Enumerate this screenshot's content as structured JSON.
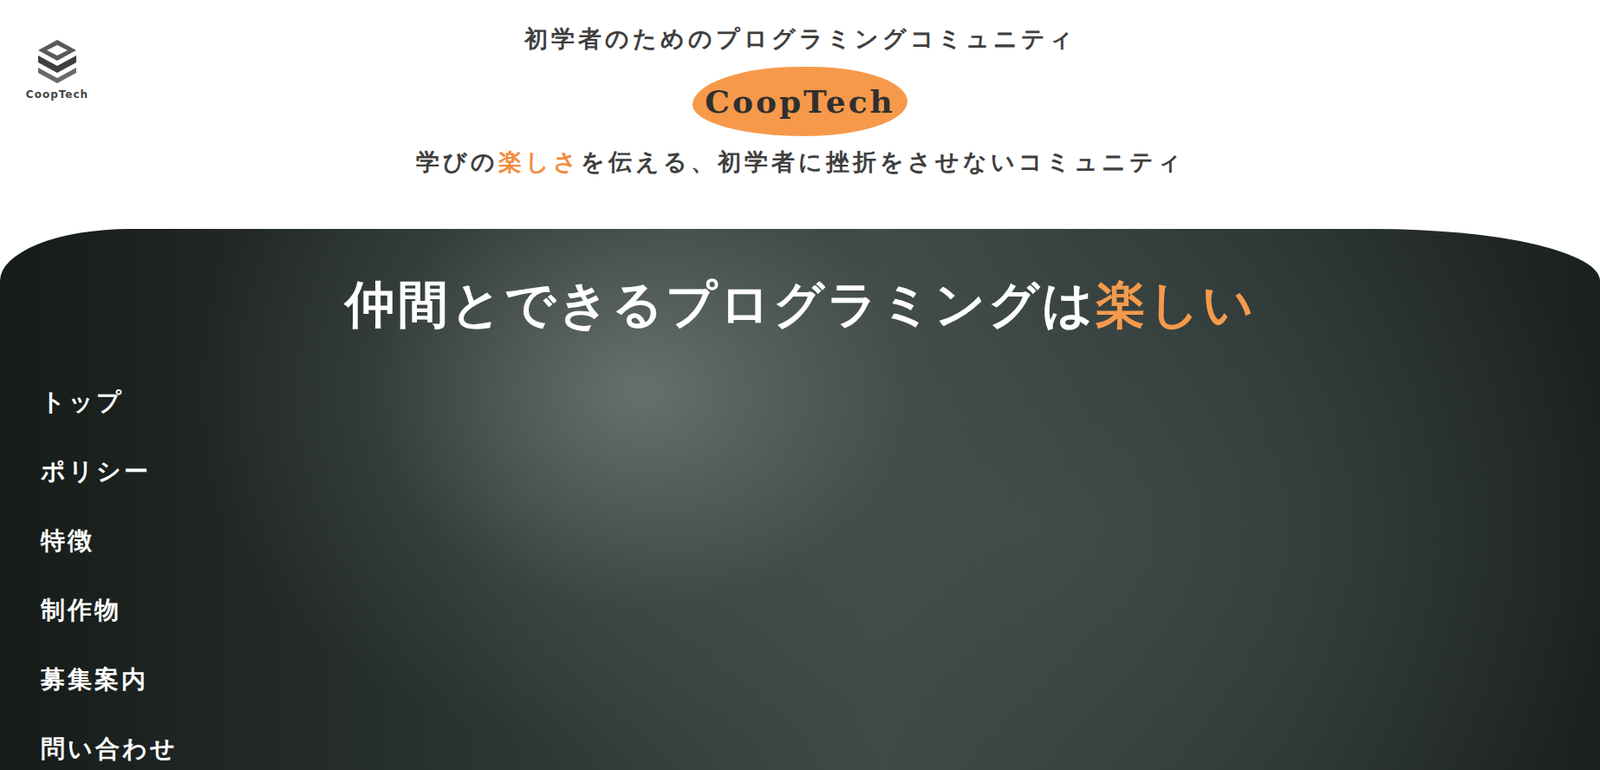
{
  "logo": {
    "text": "CoopTech"
  },
  "header": {
    "tagline": "初学者のためのプログラミングコミュニティ",
    "brand": "CoopTech",
    "subtitle": [
      {
        "text": "学びの",
        "highlight": false
      },
      {
        "text": "楽しさ",
        "highlight": true
      },
      {
        "text": "を伝える、初学者に挫折をさせないコミュニティ",
        "highlight": false
      }
    ]
  },
  "hero": {
    "title": [
      {
        "text": "仲間とできるプログラミングは",
        "highlight": false
      },
      {
        "text": "楽しい",
        "highlight": true
      }
    ]
  },
  "nav": {
    "items": [
      "トップ",
      "ポリシー",
      "特徴",
      "制作物",
      "募集案内",
      "問い合わせ"
    ]
  }
}
